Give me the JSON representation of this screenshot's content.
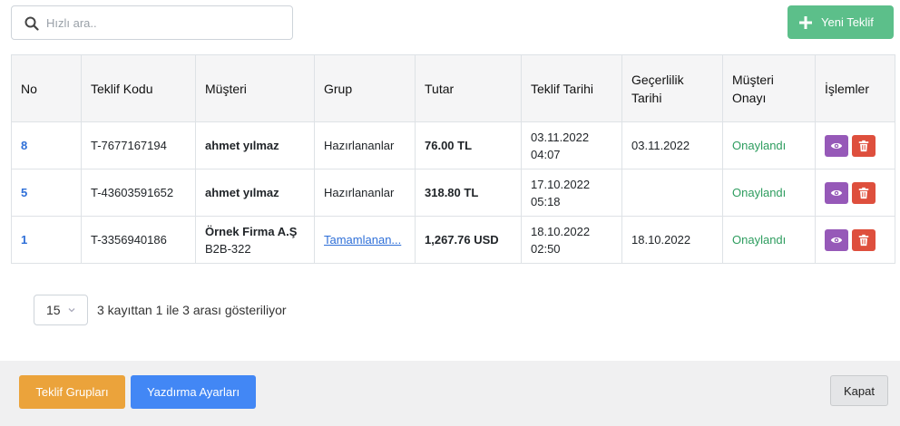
{
  "search": {
    "placeholder": "Hızlı ara.."
  },
  "toolbar": {
    "new_label": "Yeni Teklif"
  },
  "colors": {
    "new_button": "#5cbf8a",
    "link": "#2e6fd8",
    "approved": "#2e9d5f",
    "view": "#9659b8",
    "delete": "#de4f3d",
    "groups_button": "#eba33b",
    "print_button": "#4287f5"
  },
  "table": {
    "headers": [
      "No",
      "Teklif Kodu",
      "Müşteri",
      "Grup",
      "Tutar",
      "Teklif Tarihi",
      "Geçerlilik Tarihi",
      "Müşteri Onayı",
      "İşlemler"
    ],
    "rows": [
      {
        "no": "8",
        "code": "T-7677167194",
        "customer": "ahmet yılmaz",
        "customer_sub": "",
        "group": "Hazırlananlar",
        "group_link": false,
        "amount": "76.00 TL",
        "date": "03.11.2022",
        "time": "04:07",
        "valid": "03.11.2022",
        "approval": "Onaylandı"
      },
      {
        "no": "5",
        "code": "T-43603591652",
        "customer": "ahmet yılmaz",
        "customer_sub": "",
        "group": "Hazırlananlar",
        "group_link": false,
        "amount": "318.80 TL",
        "date": "17.10.2022",
        "time": "05:18",
        "valid": "",
        "approval": "Onaylandı"
      },
      {
        "no": "1",
        "code": "T-3356940186",
        "customer": "Örnek Firma A.Ş",
        "customer_sub": "B2B-322",
        "group": "Tamamlanan...",
        "group_link": true,
        "amount": "1,267.76 USD",
        "date": "18.10.2022",
        "time": "02:50",
        "valid": "18.10.2022",
        "approval": "Onaylandı"
      }
    ]
  },
  "pager": {
    "page_size": "15",
    "info": "3 kayıttan 1 ile 3 arası gösteriliyor"
  },
  "footer": {
    "groups_label": "Teklif Grupları",
    "print_label": "Yazdırma Ayarları",
    "close_label": "Kapat"
  }
}
